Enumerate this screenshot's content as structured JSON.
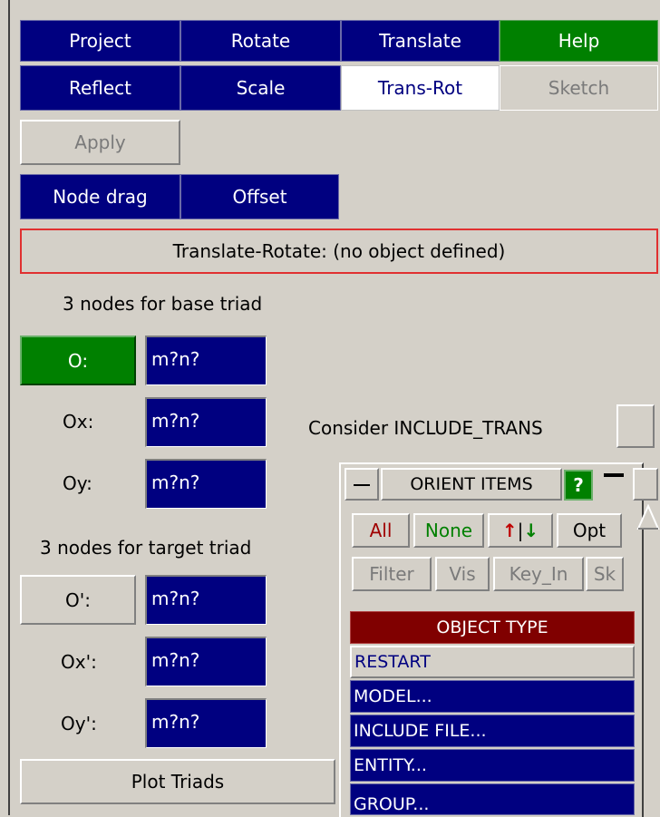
{
  "toolbar": {
    "row1": [
      "Project",
      "Rotate",
      "Translate",
      "Help"
    ],
    "row2": [
      "Reflect",
      "Scale",
      "Trans-Rot",
      "Sketch"
    ]
  },
  "apply_label": "Apply",
  "modes": [
    "Node drag",
    "Offset"
  ],
  "status_text": "Translate-Rotate: (no object defined)",
  "base_triad": {
    "heading": "3 nodes for base triad",
    "rows": [
      {
        "label": "O:",
        "value": "m?n?"
      },
      {
        "label": "Ox:",
        "value": "m?n?"
      },
      {
        "label": "Oy:",
        "value": "m?n?"
      }
    ]
  },
  "target_triad": {
    "heading": "3 nodes for target triad",
    "rows": [
      {
        "label": "O':",
        "value": "m?n?"
      },
      {
        "label": "Ox':",
        "value": "m?n?"
      },
      {
        "label": "Oy':",
        "value": "m?n?"
      }
    ]
  },
  "consider_include_label": "Consider INCLUDE_TRANS",
  "plot_triads_label": "Plot Triads",
  "orient_panel": {
    "title": "ORIENT ITEMS",
    "help_label": "?",
    "buttons_row1": [
      "All",
      "None",
      "Opt"
    ],
    "buttons_row2": [
      "Filter",
      "Vis",
      "Key_In",
      "Sk"
    ],
    "object_type_header": "OBJECT TYPE",
    "object_types": [
      "RESTART",
      "MODEL...",
      "INCLUDE FILE...",
      "ENTITY...",
      "GROUP..."
    ]
  },
  "colors": {
    "navy": "#000080",
    "green": "#008000",
    "status_border": "#e03030",
    "header_dark_red": "#800000"
  }
}
